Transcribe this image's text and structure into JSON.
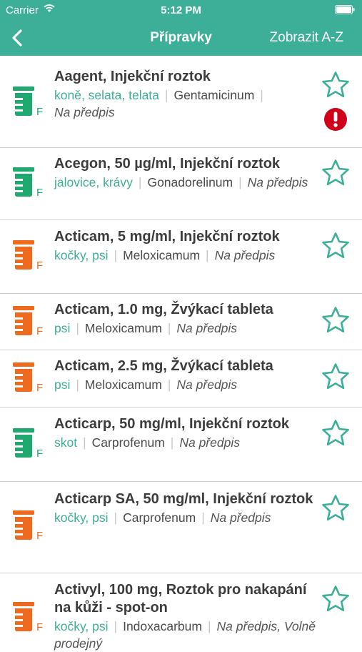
{
  "status": {
    "carrier": "Carrier",
    "time": "5:12 PM"
  },
  "nav": {
    "title": "Přípravky",
    "right_label": "Zobrazit A-Z"
  },
  "colors": {
    "accent": "#3daf98",
    "green_icon": "#1fa870",
    "orange_icon": "#ee6a1f",
    "alert": "#d0021b"
  },
  "items": [
    {
      "title": "Aagent, Injekční roztok",
      "species": "koně, selata, telata",
      "substance": "Gentamicinum",
      "rx": "Na předpis",
      "form": "F",
      "icon_color": "green",
      "alert": true
    },
    {
      "title": "Acegon, 50 µg/ml, Injekční roztok",
      "species": "jalovice, krávy",
      "substance": "Gonadorelinum",
      "rx": "Na předpis",
      "form": "F",
      "icon_color": "green",
      "alert": false
    },
    {
      "title": "Acticam, 5 mg/ml, Injekční roztok",
      "species": "kočky, psi",
      "substance": "Meloxicamum",
      "rx": "Na předpis",
      "form": "F",
      "icon_color": "orange",
      "alert": false
    },
    {
      "title": "Acticam, 1.0 mg, Žvýkací tableta",
      "species": "psi",
      "substance": "Meloxicamum",
      "rx": "Na předpis",
      "form": "F",
      "icon_color": "orange",
      "alert": false
    },
    {
      "title": "Acticam, 2.5 mg, Žvýkací tableta",
      "species": "psi",
      "substance": "Meloxicamum",
      "rx": "Na předpis",
      "form": "F",
      "icon_color": "orange",
      "alert": false
    },
    {
      "title": "Acticarp, 50 mg/ml, Injekční roztok",
      "species": "skot",
      "substance": "Carprofenum",
      "rx": "Na předpis",
      "form": "F",
      "icon_color": "green",
      "alert": false
    },
    {
      "title": "Acticarp SA, 50 mg/ml, Injekční roztok",
      "species": "kočky, psi",
      "substance": "Carprofenum",
      "rx": "Na předpis",
      "form": "F",
      "icon_color": "orange",
      "alert": false
    },
    {
      "title": "Activyl, 100 mg, Roztok pro nakapání na kůži - spot-on",
      "species": "kočky, psi",
      "substance": "Indoxacarbum",
      "rx": "Na předpis, Volně prodejný",
      "form": "F",
      "icon_color": "orange",
      "alert": false
    }
  ]
}
